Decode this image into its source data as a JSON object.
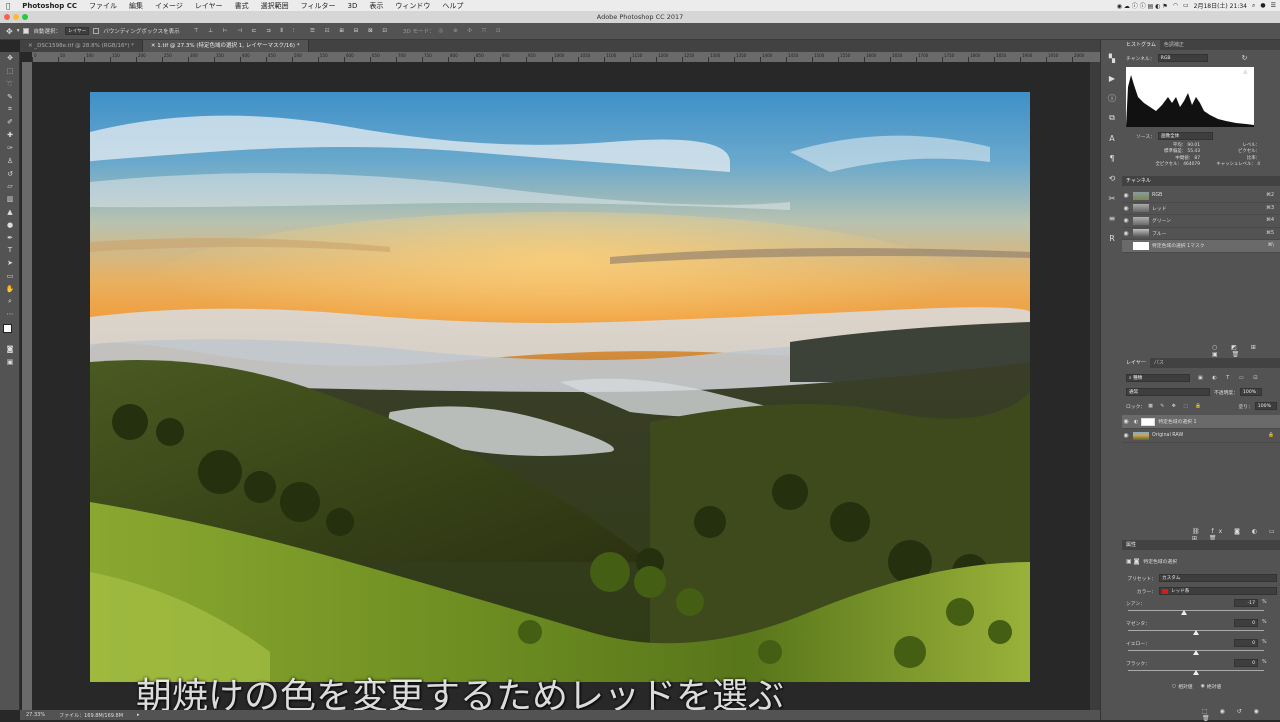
{
  "menubar": {
    "app": "Photoshop CC",
    "items": [
      "ファイル",
      "編集",
      "イメージ",
      "レイヤー",
      "書式",
      "選択範囲",
      "フィルター",
      "3D",
      "表示",
      "ウィンドウ",
      "ヘルプ"
    ],
    "clock": "2月18日(土) 21:34"
  },
  "window": {
    "title": "Adobe Photoshop CC 2017"
  },
  "options": {
    "auto_select": "自動選択：",
    "layer_select": "レイヤー",
    "bbox": "バウンディングボックスを表示",
    "mode3d": "3D モード："
  },
  "tabs": [
    "_DSC1598e.tif @ 28.8% (RGB/16*) *",
    "1.tif @ 27.3% (特定色域の選択 1, レイヤーマスク/16) *"
  ],
  "ruler_ticks": [
    "0",
    "50",
    "100",
    "150",
    "200",
    "250",
    "300",
    "350",
    "400",
    "450",
    "500",
    "550",
    "600",
    "650",
    "700",
    "750",
    "800",
    "850",
    "900",
    "950",
    "1000",
    "1050",
    "1100",
    "1150",
    "1200",
    "1250",
    "1300",
    "1350",
    "1400",
    "1450",
    "1500",
    "1550",
    "1600",
    "1650",
    "1700",
    "1750",
    "1800",
    "1850",
    "1900",
    "1950",
    "2000"
  ],
  "subtitle": "朝焼けの色を変更するためレッドを選ぶ",
  "status": {
    "zoom": "27.33%",
    "file": "ファイル：169.8M/169.8M"
  },
  "histogram": {
    "tabs": [
      "ヒストグラム",
      "色調補正"
    ],
    "channel_label": "チャンネル：",
    "channel_value": "RGB",
    "source_label": "ソース：",
    "source_value": "画像全体",
    "stats": {
      "mean_label": "平均：",
      "mean": "90.01",
      "std_label": "標準偏差：",
      "std": "55.43",
      "median_label": "中間値：",
      "median": "87",
      "pixels_label": "全ピクセル：",
      "pixels": "464079",
      "level_label": "レベル：",
      "count_label": "ピクセル：",
      "percent_label": "比率：",
      "cache_label": "キャッシュレベル：",
      "cache": "4"
    }
  },
  "channels": {
    "title": "チャンネル",
    "items": [
      {
        "name": "RGB",
        "key": "⌘2"
      },
      {
        "name": "レッド",
        "key": "⌘3"
      },
      {
        "name": "グリーン",
        "key": "⌘4"
      },
      {
        "name": "ブルー",
        "key": "⌘5"
      },
      {
        "name": "特定色域の選択 1マスク",
        "key": "⌘\\"
      }
    ]
  },
  "layers": {
    "tabs": [
      "レイヤー",
      "パス"
    ],
    "filter": "種類",
    "blend": "通常",
    "opacity_label": "不透明度：",
    "opacity": "100%",
    "lock_label": "ロック：",
    "fill_label": "塗り：",
    "fill": "100%",
    "items": [
      {
        "name": "特定色域の選択 1"
      },
      {
        "name": "Original RAW"
      }
    ]
  },
  "properties": {
    "title": "属性",
    "adjustment": "特定色域の選択",
    "preset_label": "プリセット：",
    "preset": "カスタム",
    "color_label": "カラー：",
    "color": "レッド系",
    "swatch": "#cc1f1f",
    "sliders": [
      {
        "label": "シアン：",
        "value": "-17",
        "pct": "%",
        "level": 0.415
      },
      {
        "label": "マゼンタ：",
        "value": "0",
        "pct": "%",
        "level": 0.5
      },
      {
        "label": "イエロー：",
        "value": "0",
        "pct": "%",
        "level": 0.5
      },
      {
        "label": "ブラック：",
        "value": "0",
        "pct": "%",
        "level": 0.5
      }
    ],
    "relative": "相対値",
    "absolute": "絶対値"
  }
}
